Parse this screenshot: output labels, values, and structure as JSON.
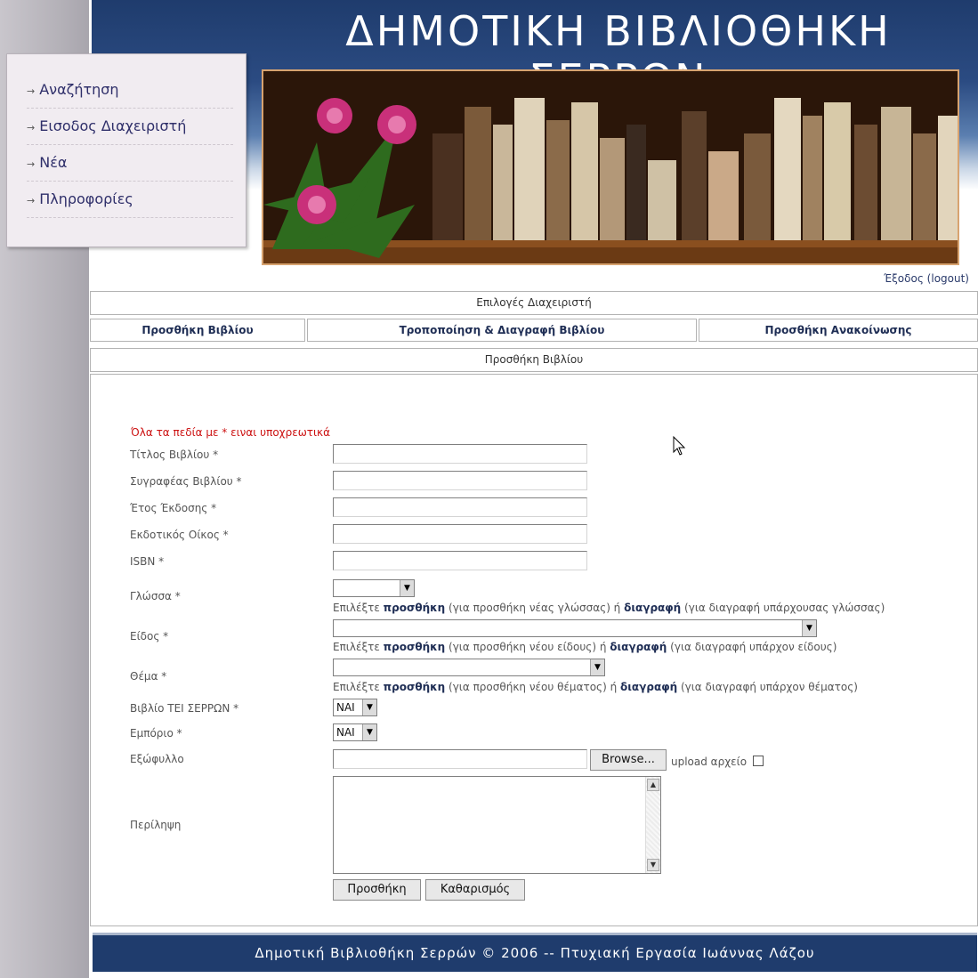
{
  "header": {
    "title": "ΔΗΜΟΤΙΚΗ ΒΙΒΛΙΟΘΗΚΗ ΣΕΡΡΩΝ"
  },
  "sidebar": {
    "items": [
      {
        "label": "Αναζήτηση"
      },
      {
        "label": "Εισοδος Διαχειριστή"
      },
      {
        "label": "Νέα"
      },
      {
        "label": "Πληροφορίες"
      }
    ]
  },
  "logout": "Έξοδος (logout)",
  "admin_options": "Επιλογές Διαχειριστή",
  "tabs": [
    {
      "label": "Προσθήκη Βιβλίου"
    },
    {
      "label": "Τροποποίηση & Διαγραφή Βιβλίου"
    },
    {
      "label": "Προσθήκη Ανακοίνωσης"
    }
  ],
  "section_title": "Προσθήκη Βιβλίου",
  "form": {
    "required_note": "Όλα τα πεδία με * ειναι υποχρεωτικά",
    "labels": {
      "title": "Τίτλος Βιβλίου *",
      "author": "Συγραφέας Βιβλίου *",
      "year": "Έτος Έκδοσης *",
      "publisher": "Εκδοτικός Οίκος *",
      "isbn": "ISBN *",
      "language": "Γλώσσα *",
      "genre": "Είδος *",
      "subject": "Θέμα *",
      "tei_book": "Βιβλίο ΤΕΙ ΣΕΡΡΩΝ *",
      "commercial": "Εμπόριο *",
      "cover": "Εξώφυλλο",
      "summary": "Περίληψη"
    },
    "hints": {
      "lang_pre": "Επιλέξτε ",
      "lang_add": "προσθήκη",
      "lang_mid": " (για προσθήκη νέας γλώσσας) ή ",
      "lang_del": "διαγραφή",
      "lang_post": " (για διαγραφή υπάρχουσας γλώσσας)",
      "genre_pre": "Επιλέξτε ",
      "genre_add": "προσθήκη",
      "genre_mid": " (για προσθήκη νέου είδους) ή ",
      "genre_del": "διαγραφή",
      "genre_post": " (για διαγραφή υπάρχον είδους)",
      "subject_pre": "Επιλέξτε ",
      "subject_add": "προσθήκη",
      "subject_mid": " (για προσθήκη νέου θέματος) ή ",
      "subject_del": "διαγραφή",
      "subject_post": " (για διαγραφή υπάρχον θέματος)"
    },
    "selects": {
      "tei_book": "ΝΑΙ",
      "commercial": "ΝΑΙ"
    },
    "browse_label": "Browse...",
    "upload_label": "upload αρχείο",
    "submit_label": "Προσθήκη",
    "reset_label": "Καθαρισμός"
  },
  "footer": "Δημοτική Βιβλιοθήκη Σερρών © 2006 -- Πτυχιακή Εργασία Ιωάννας Λάζου",
  "colors": {
    "navy": "#1f3c6d",
    "required_red": "#cc1111",
    "link_navy": "#1f2e55"
  }
}
